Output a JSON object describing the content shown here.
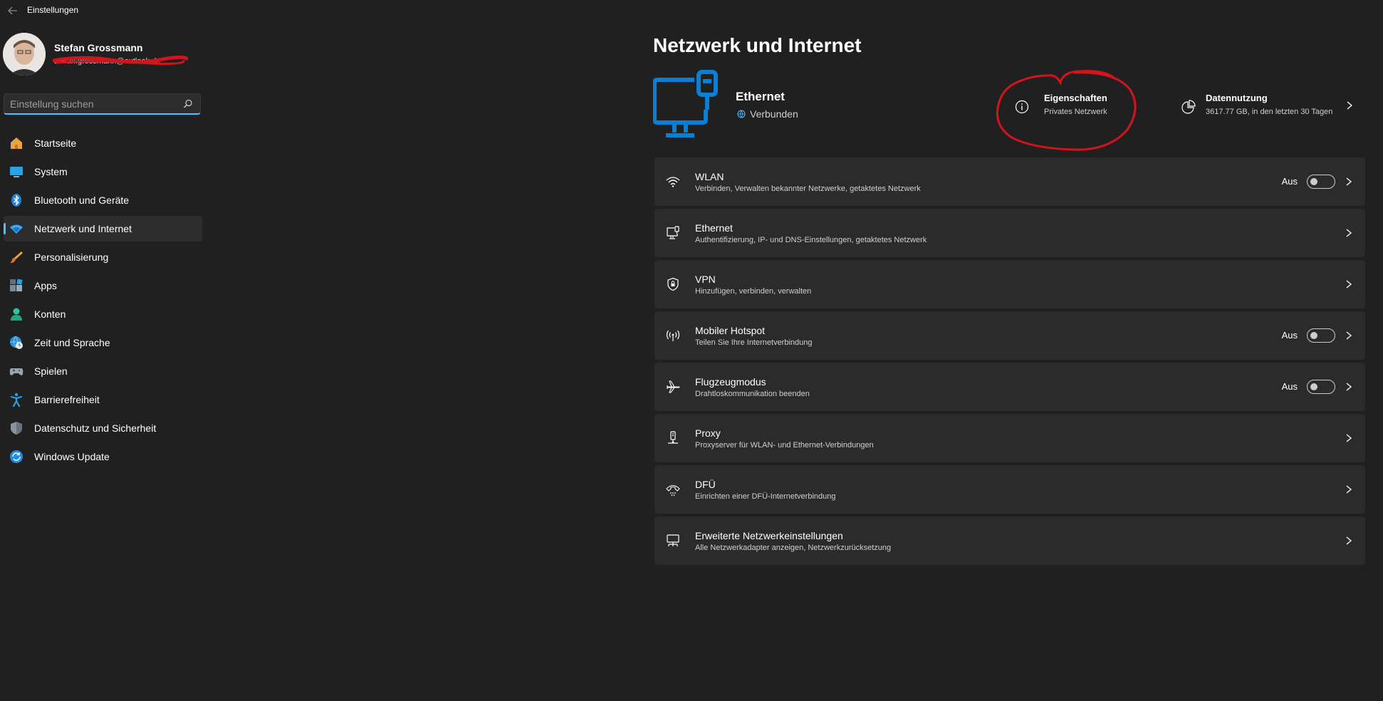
{
  "app": {
    "title": "Einstellungen"
  },
  "user": {
    "name": "Stefan Grossmann",
    "email": "stefan.grossmann@outlook.de"
  },
  "search": {
    "placeholder": "Einstellung suchen"
  },
  "nav": [
    {
      "label": "Startseite",
      "icon": "home-icon"
    },
    {
      "label": "System",
      "icon": "system-icon"
    },
    {
      "label": "Bluetooth und Geräte",
      "icon": "bluetooth-icon"
    },
    {
      "label": "Netzwerk und Internet",
      "icon": "network-icon",
      "active": true
    },
    {
      "label": "Personalisierung",
      "icon": "brush-icon"
    },
    {
      "label": "Apps",
      "icon": "apps-icon"
    },
    {
      "label": "Konten",
      "icon": "account-icon"
    },
    {
      "label": "Zeit und Sprache",
      "icon": "globe-clock-icon"
    },
    {
      "label": "Spielen",
      "icon": "gamepad-icon"
    },
    {
      "label": "Barrierefreiheit",
      "icon": "accessibility-icon"
    },
    {
      "label": "Datenschutz und Sicherheit",
      "icon": "shield-icon"
    },
    {
      "label": "Windows Update",
      "icon": "update-icon"
    }
  ],
  "page": {
    "title": "Netzwerk und Internet"
  },
  "hero": {
    "name": "Ethernet",
    "status": "Verbunden",
    "properties": {
      "title": "Eigenschaften",
      "subtitle": "Privates Netzwerk"
    },
    "usage": {
      "title": "Datennutzung",
      "subtitle": "3617.77 GB, in den letzten 30 Tagen"
    }
  },
  "rows": [
    {
      "title": "WLAN",
      "subtitle": "Verbinden, Verwalten bekannter Netzwerke, getaktetes Netzwerk",
      "icon": "wifi-icon",
      "toggle": "Aus"
    },
    {
      "title": "Ethernet",
      "subtitle": "Authentifizierung, IP- und DNS-Einstellungen, getaktetes Netzwerk",
      "icon": "ethernet-icon"
    },
    {
      "title": "VPN",
      "subtitle": "Hinzufügen, verbinden, verwalten",
      "icon": "vpn-shield-icon"
    },
    {
      "title": "Mobiler Hotspot",
      "subtitle": "Teilen Sie Ihre Internetverbindung",
      "icon": "hotspot-icon",
      "toggle": "Aus"
    },
    {
      "title": "Flugzeugmodus",
      "subtitle": "Drahtloskommunikation beenden",
      "icon": "airplane-icon",
      "toggle": "Aus"
    },
    {
      "title": "Proxy",
      "subtitle": "Proxyserver für WLAN- und Ethernet-Verbindungen",
      "icon": "proxy-icon"
    },
    {
      "title": "DFÜ",
      "subtitle": "Einrichten einer DFÜ-Internetverbindung",
      "icon": "dialup-icon"
    },
    {
      "title": "Erweiterte Netzwerkeinstellungen",
      "subtitle": "Alle Netzwerkadapter anzeigen, Netzwerkzurücksetzung",
      "icon": "advanced-network-icon"
    }
  ],
  "colors": {
    "accent": "#4cc2ff",
    "hero_icon": "#0a7fd6",
    "annotation": "#d4141c",
    "background": "#202020",
    "card": "#2b2b2b"
  }
}
